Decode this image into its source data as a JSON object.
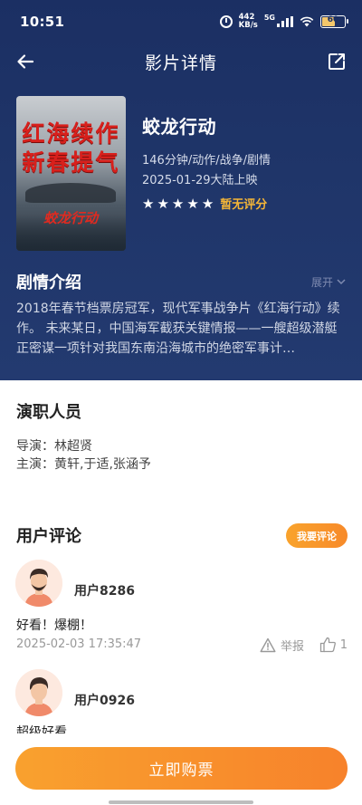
{
  "status_bar": {
    "time": "10:51",
    "speed_value": "442",
    "speed_unit": "KB/s",
    "network": "5G",
    "battery": "60"
  },
  "nav": {
    "title": "影片详情"
  },
  "poster": {
    "line1": "红海续作",
    "line2": "新春提气",
    "logo": "蛟龙行动"
  },
  "movie": {
    "title": "蛟龙行动",
    "duration_genres": "146分钟/动作/战争/剧情",
    "release": "2025-01-29大陆上映",
    "stars": 5,
    "rating_text": "暂无评分"
  },
  "plot": {
    "title": "剧情介绍",
    "expand_label": "展开",
    "text": "2018年春节档票房冠军，现代军事战争片《红海行动》续作。 未来某日，中国海军截获关键情报——一艘超级潜艇正密谋一项针对我国东南沿海城市的绝密军事计…"
  },
  "cast": {
    "title": "演职人员",
    "director": "导演：林超贤",
    "actors": "主演：黄轩,于适,张涵予"
  },
  "comments": {
    "title": "用户评论",
    "write_label": "我要评论",
    "items": [
      {
        "user": "用户8286",
        "text": "好看！爆棚！",
        "date": "2025-02-03 17:35:47",
        "report_label": "举报",
        "likes": "1"
      },
      {
        "user": "用户0926",
        "text": "超级好看"
      }
    ]
  },
  "buy_button": "立即购票",
  "colors": {
    "header_bg": "#1f3569",
    "accent": "#f7892b",
    "rating_text": "#f5b637"
  }
}
